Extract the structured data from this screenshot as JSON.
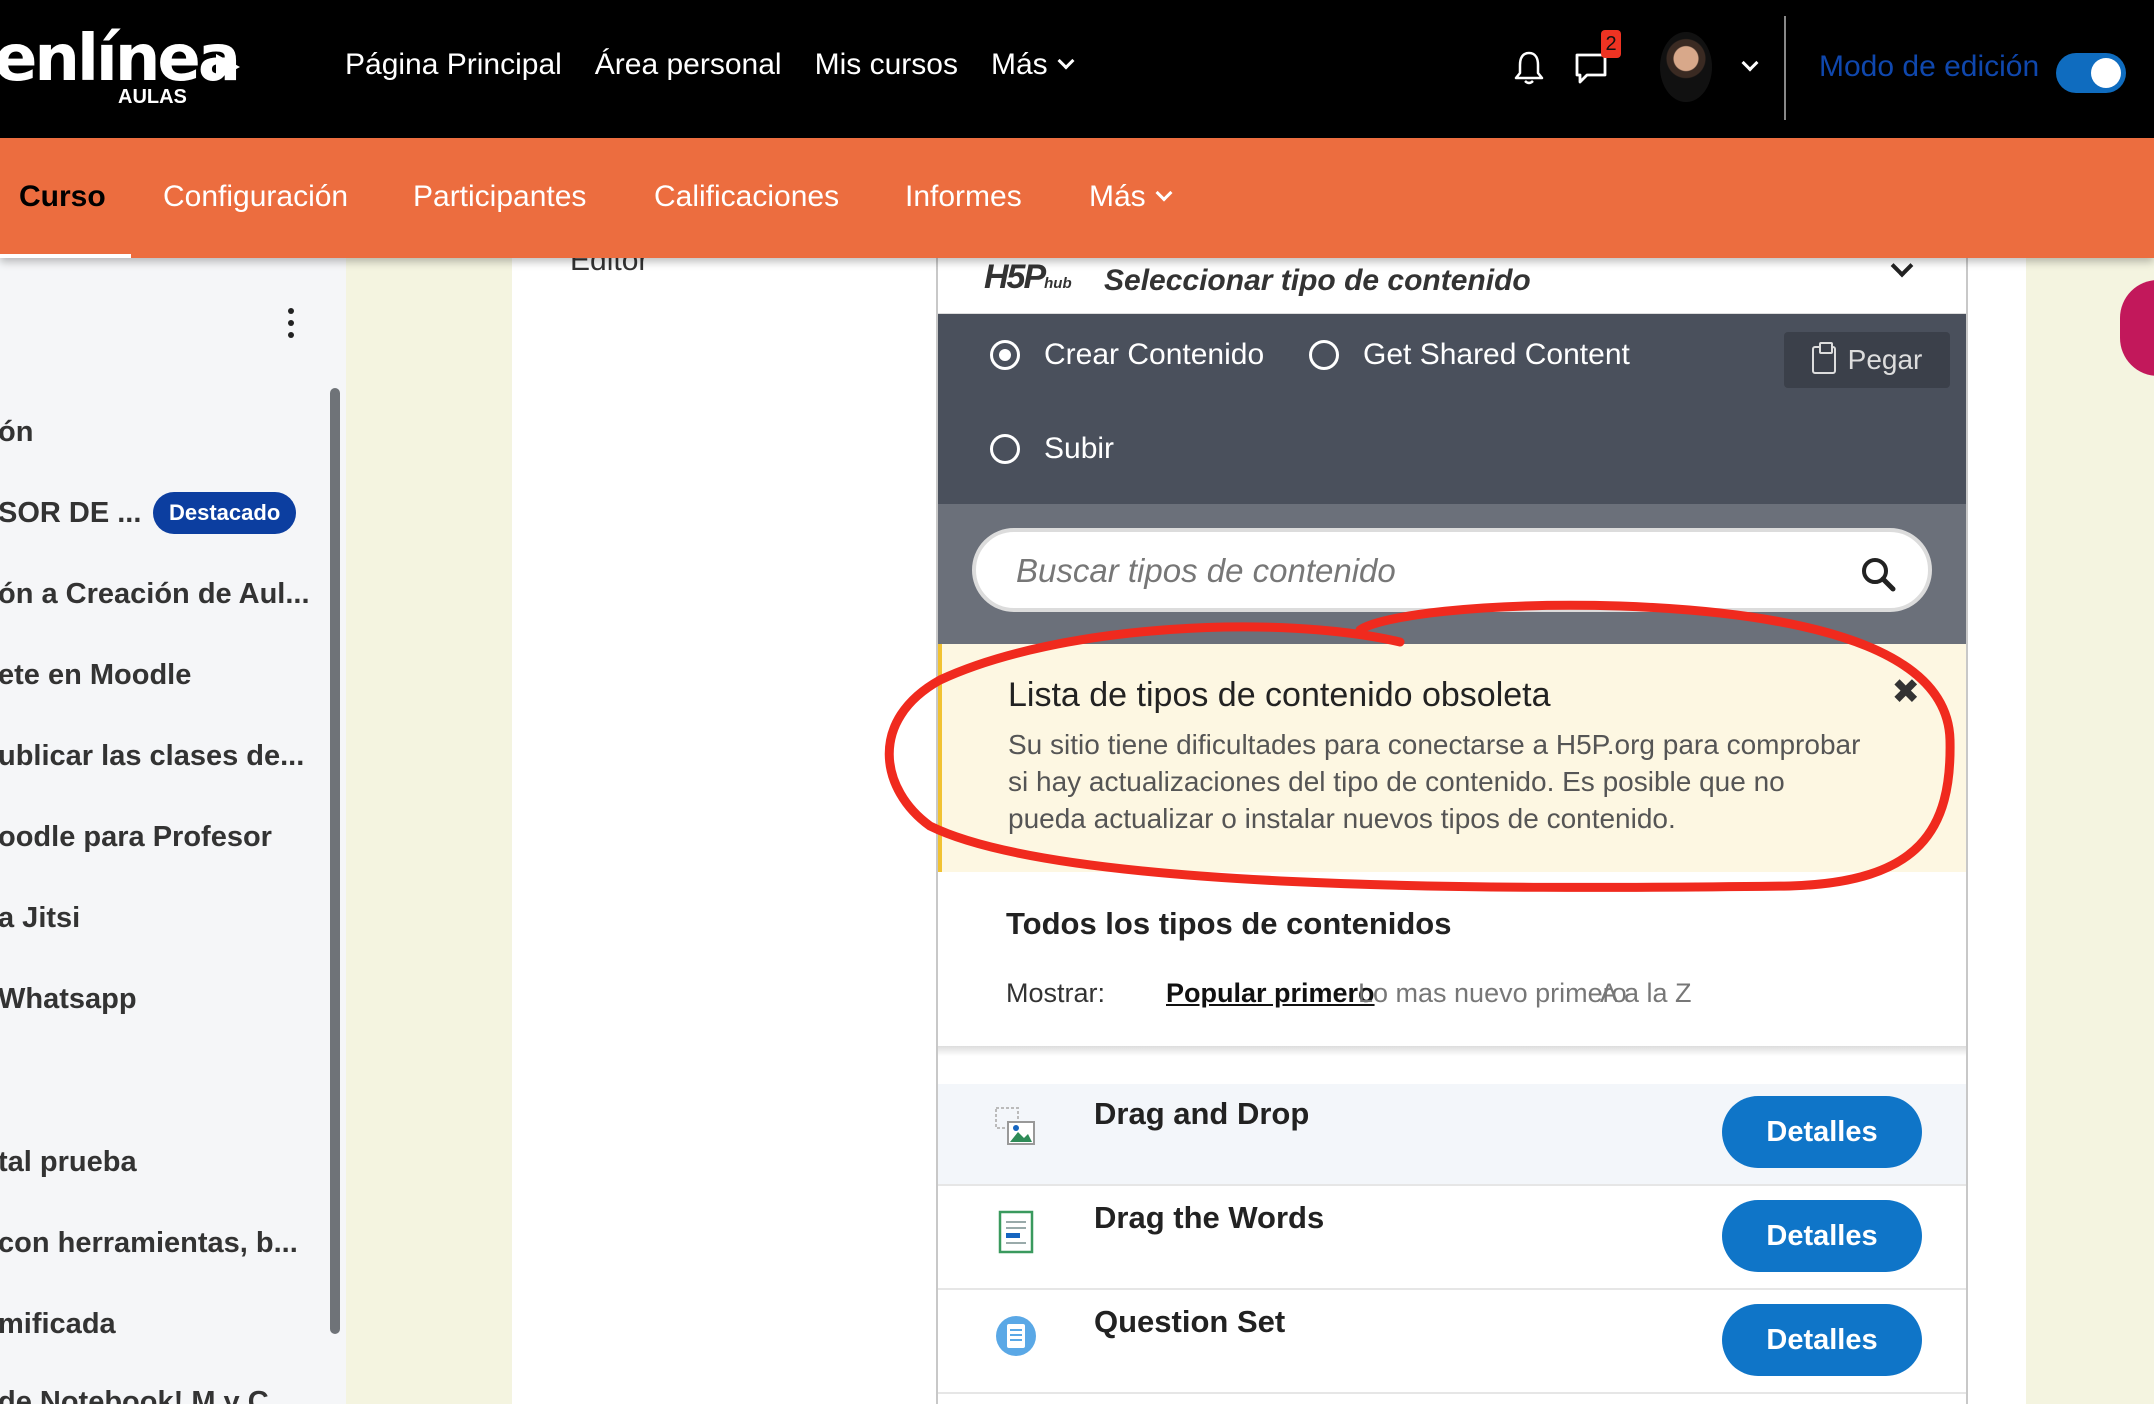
{
  "brand": {
    "wordmark": "enlínea",
    "sub": "AULAS"
  },
  "nav": {
    "items": [
      "Página Principal",
      "Área personal",
      "Mis cursos",
      "Más"
    ],
    "notification_count": "2",
    "edit_mode_label": "Modo de edición"
  },
  "course_nav": {
    "items": [
      "Curso",
      "Configuración",
      "Participantes",
      "Calificaciones",
      "Informes",
      "Más"
    ]
  },
  "drawer": {
    "links": [
      "ón",
      "SOR DE ...",
      "ón a Creación de Aul...",
      "ete en Moodle",
      "ublicar las clases de...",
      "oodle para Profesor",
      "a Jitsi",
      "Whatsapp",
      "tal prueba",
      "con herramientas, b...",
      "mificada",
      "de Notebook! M y C..."
    ],
    "featured_badge": "Destacado"
  },
  "main": {
    "editor_label": "Editor"
  },
  "h5p": {
    "logo": "H5P",
    "logo_suffix": "hub",
    "select_label": "Seleccionar tipo de contenido",
    "tabs": [
      "Crear Contenido",
      "Get Shared Content",
      "Subir"
    ],
    "paste_label": "Pegar",
    "search_placeholder": "Buscar tipos de contenido",
    "warning": {
      "title": "Lista de tipos de contenido obsoleta",
      "message": "Su sitio tiene dificultades para conectarse a H5P.org para comprobar si hay actualizaciones del tipo de contenido. Es posible que no pueda actualizar o instalar nuevos tipos de contenido.",
      "close": "✖"
    },
    "all_title": "Todos los tipos de contenidos",
    "show_label": "Mostrar:",
    "sort_options": [
      "Popular primero",
      "Lo mas nuevo primero",
      "A a la Z"
    ],
    "content_types": [
      {
        "name": "Drag and Drop",
        "button": "Detalles"
      },
      {
        "name": "Drag the Words",
        "button": "Detalles"
      },
      {
        "name": "Question Set",
        "button": "Detalles"
      }
    ]
  },
  "colors": {
    "topbar": "#000000",
    "course_nav": "#ec6d3f",
    "featured_badge": "#0c3ea0",
    "primary_button": "#0f75c8",
    "annotation": "#f02a1e",
    "warning_bg": "#fdf7e2"
  },
  "icons": [
    "bell-icon",
    "chat-icon",
    "chevron-down-icon",
    "clipboard-icon",
    "search-icon",
    "close-icon",
    "drag-drop-icon",
    "drag-words-icon",
    "question-set-icon"
  ]
}
